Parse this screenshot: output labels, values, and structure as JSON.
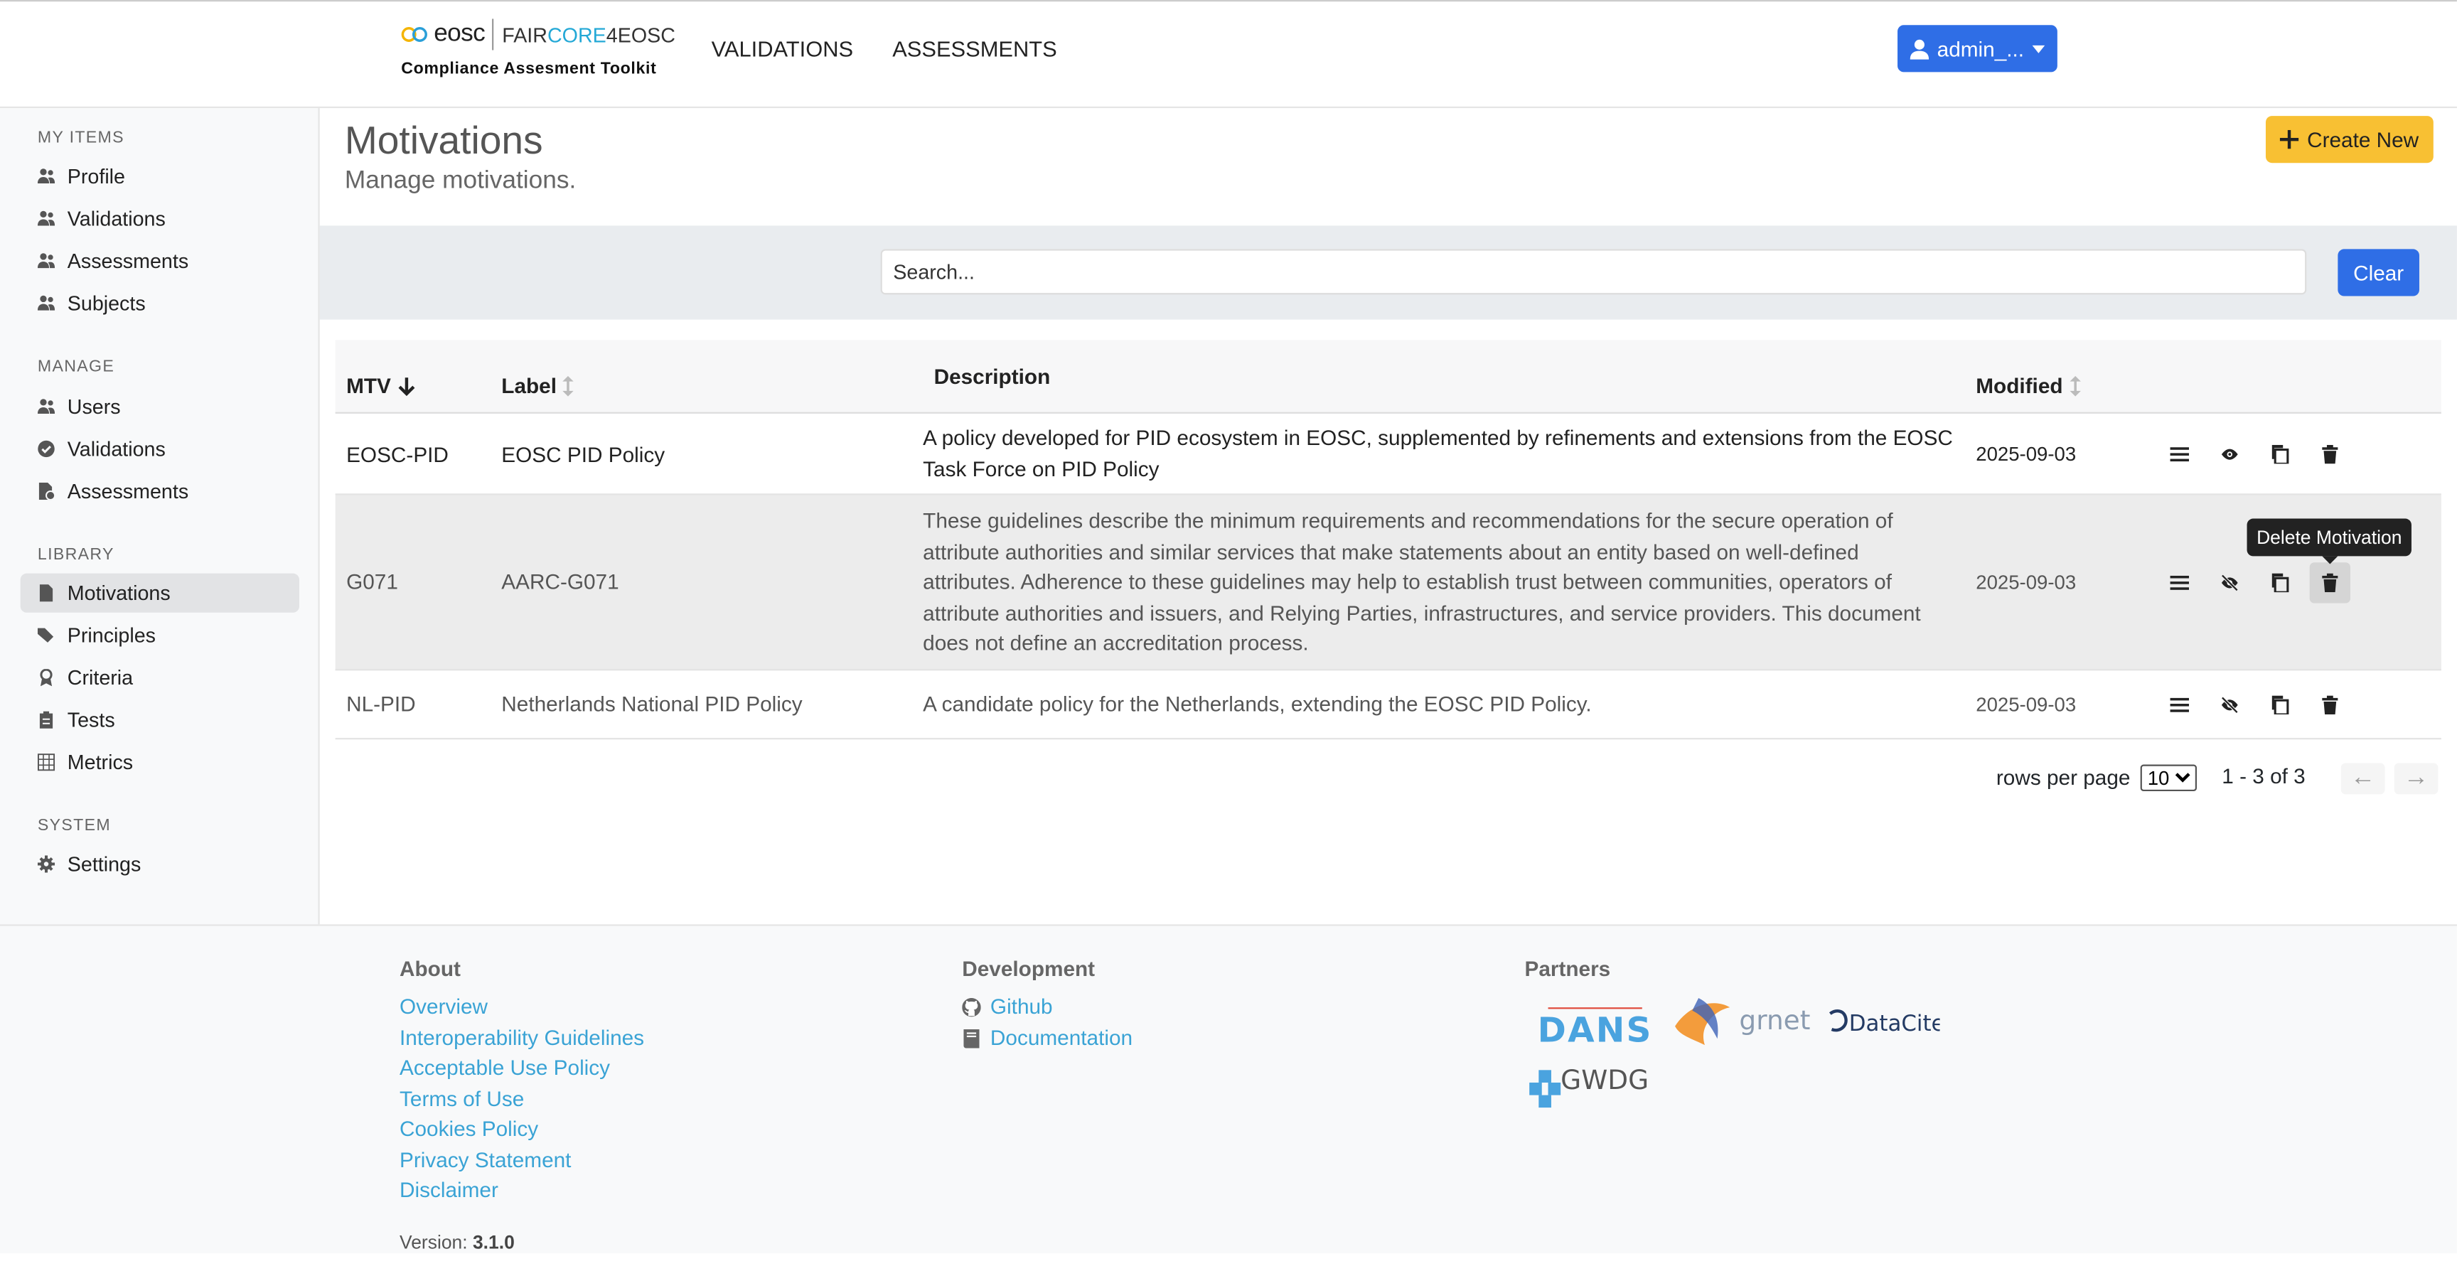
{
  "header": {
    "logo_eosc": "eosc",
    "logo_faircore": "FAIR",
    "logo_core": "CORE",
    "logo_4eosc": "4EOSC",
    "logo_subtitle": "Compliance Assesment Toolkit",
    "nav": [
      "VALIDATIONS",
      "ASSESSMENTS"
    ],
    "user_label": "admin_..."
  },
  "sidebar": {
    "sections": [
      {
        "title": "MY ITEMS",
        "items": [
          {
            "label": "Profile",
            "icon": "users-icon"
          },
          {
            "label": "Validations",
            "icon": "users-icon"
          },
          {
            "label": "Assessments",
            "icon": "users-icon"
          },
          {
            "label": "Subjects",
            "icon": "users-icon"
          }
        ]
      },
      {
        "title": "MANAGE",
        "items": [
          {
            "label": "Users",
            "icon": "users-icon"
          },
          {
            "label": "Validations",
            "icon": "check-circle-icon"
          },
          {
            "label": "Assessments",
            "icon": "file-chart-icon"
          }
        ]
      },
      {
        "title": "LIBRARY",
        "items": [
          {
            "label": "Motivations",
            "icon": "file-icon",
            "active": true
          },
          {
            "label": "Principles",
            "icon": "tags-icon"
          },
          {
            "label": "Criteria",
            "icon": "award-icon"
          },
          {
            "label": "Tests",
            "icon": "clipboard-icon"
          },
          {
            "label": "Metrics",
            "icon": "grid-icon"
          }
        ]
      },
      {
        "title": "SYSTEM",
        "items": [
          {
            "label": "Settings",
            "icon": "gear-icon"
          }
        ]
      }
    ]
  },
  "page": {
    "title": "Motivations",
    "subtitle": "Manage motivations.",
    "create_label": "Create New"
  },
  "search": {
    "placeholder": "Search...",
    "clear_label": "Clear"
  },
  "table": {
    "columns": [
      "MTV",
      "Label",
      "Description",
      "Modified"
    ],
    "rows": [
      {
        "mtv": "EOSC-PID",
        "label": "EOSC PID Policy",
        "description": "A policy developed for PID ecosystem in EOSC, supplemented by refinements and extensions from the EOSC Task Force on PID Policy",
        "modified": "2025-09-03",
        "visibility_icon": "eye-icon"
      },
      {
        "mtv": "G071",
        "label": "AARC-G071",
        "description": "These guidelines describe the minimum requirements and recommendations for the secure operation of attribute authorities and similar services that make statements about an entity based on well-defined attributes. Adherence to these guidelines may help to establish trust between communities, operators of attribute authorities and issuers, and Relying Parties, infrastructures, and service providers. This document does not define an accreditation process.",
        "modified": "2025-09-03",
        "visibility_icon": "eye-slash-icon"
      },
      {
        "mtv": "NL-PID",
        "label": "Netherlands National PID Policy",
        "description": "A candidate policy for the Netherlands, extending the EOSC PID Policy.",
        "modified": "2025-09-03",
        "visibility_icon": "eye-slash-icon"
      }
    ],
    "tooltip": "Delete Motivation"
  },
  "pagination": {
    "rows_per_page_label": "rows per page",
    "rows_per_page_value": "10",
    "range": "1 - 3 of 3"
  },
  "footer": {
    "about_title": "About",
    "about_links": [
      "Overview",
      "Interoperability Guidelines",
      "Acceptable Use Policy",
      "Terms of Use",
      "Cookies Policy",
      "Privacy Statement",
      "Disclaimer"
    ],
    "dev_title": "Development",
    "dev_links": [
      "Github",
      "Documentation"
    ],
    "partners_title": "Partners",
    "partners": [
      "DANS",
      "grnet",
      "DataCite",
      "GWDG"
    ],
    "version_label": "Version:",
    "version": "3.1.0"
  },
  "colors": {
    "primary": "#2f6ee6",
    "warning": "#f8c033",
    "link": "#3aa3d5"
  }
}
